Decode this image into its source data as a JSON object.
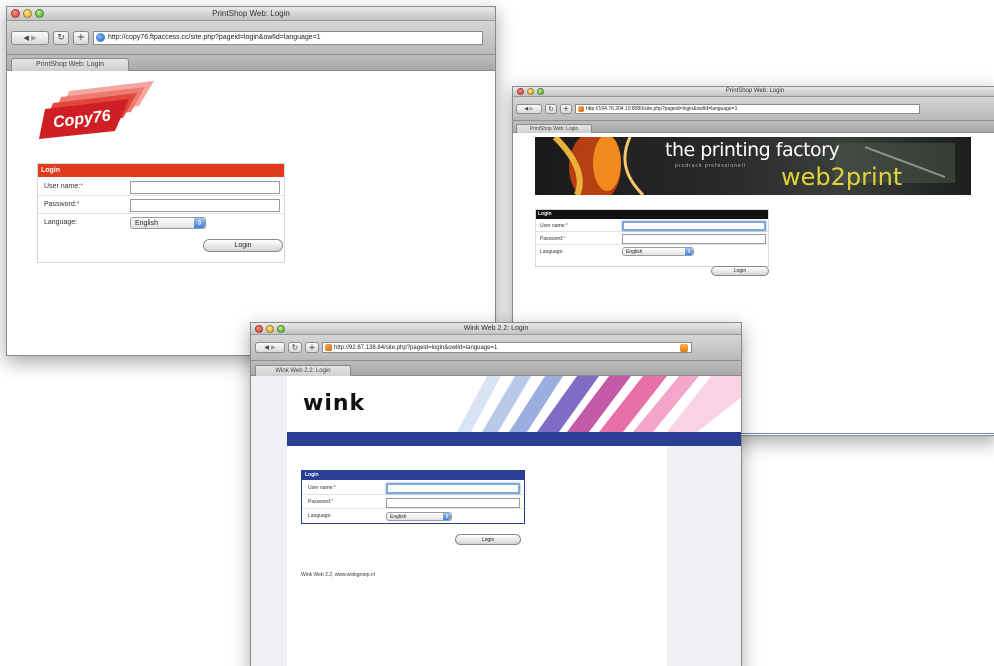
{
  "windows": {
    "copy76": {
      "title": "PrintShop Web: Login",
      "url": "http://copy76.ftpaccess.cc/site.php?pageid=login&owlId=language=1",
      "tab": "PrintShop Web: Login",
      "logo_text": "Copy76",
      "panel_title": "Login",
      "username_label": "User name:",
      "password_label": "Password:",
      "language_label": "Language:",
      "language_value": "English",
      "login_button": "Login",
      "required_mark": "*",
      "accent": "#e03c1c"
    },
    "printing_factory": {
      "title": "PrintShop Web: Login",
      "url": "http://194.76.204.10:8080/site.php?pageid=login&owlId=language=1",
      "tab": "PrintShop Web: Login",
      "banner_title": "the printing factory",
      "banner_tagline": "prodruck professionell",
      "banner_subtitle": "web2print",
      "panel_title": "Login",
      "username_label": "User name:",
      "password_label": "Password:",
      "language_label": "Language:",
      "language_value": "English",
      "login_button": "Login",
      "required_mark": "*",
      "accent": "#111111"
    },
    "wink": {
      "title": "Wink Web 2.2: Login",
      "url": "http://92.67.138.84/site.php?pageid=login&owlId=language=1",
      "tab": "Wink Web 2.2: Login",
      "logo_text": "wink",
      "panel_title": "Login",
      "username_label": "User name:",
      "password_label": "Password:",
      "language_label": "Language:",
      "language_value": "English",
      "login_button": "Login",
      "required_mark": "*",
      "footer": "Wink Web 2.2, www.winkgroep.nl",
      "accent": "#2a3f94"
    }
  },
  "icons": {
    "back": "◀",
    "forward": "▶",
    "reload": "↻",
    "add": "+",
    "dropdown": "⇕"
  }
}
